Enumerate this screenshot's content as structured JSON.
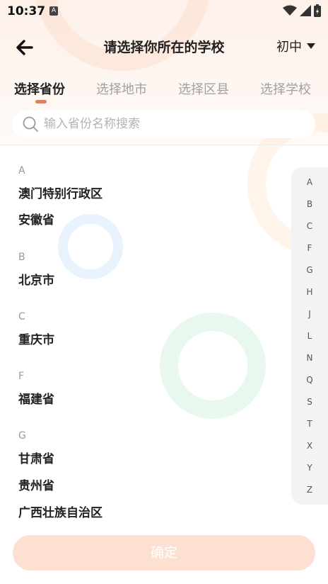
{
  "status_bar": {
    "time": "10:37",
    "notification_glyph": "A"
  },
  "header": {
    "title": "请选择你所在的学校",
    "grade": "初中"
  },
  "tabs": [
    {
      "label": "选择省份",
      "active": true
    },
    {
      "label": "选择地市",
      "active": false
    },
    {
      "label": "选择区县",
      "active": false
    },
    {
      "label": "选择学校",
      "active": false
    }
  ],
  "search": {
    "placeholder": "输入省份名称搜索"
  },
  "groups": [
    {
      "letter": "A",
      "items": [
        "澳门特别行政区",
        "安徽省"
      ]
    },
    {
      "letter": "B",
      "items": [
        "北京市"
      ]
    },
    {
      "letter": "C",
      "items": [
        "重庆市"
      ]
    },
    {
      "letter": "F",
      "items": [
        "福建省"
      ]
    },
    {
      "letter": "G",
      "items": [
        "甘肃省",
        "贵州省",
        "广西壮族自治区"
      ]
    }
  ],
  "index_letters": [
    "A",
    "B",
    "C",
    "F",
    "G",
    "H",
    "J",
    "L",
    "N",
    "Q",
    "S",
    "T",
    "X",
    "Y",
    "Z"
  ],
  "confirm_label": "确定",
  "colors": {
    "accent": "#f37a4f",
    "confirm_disabled": "#fde0d2",
    "background_tint": "#fdf1ea"
  }
}
